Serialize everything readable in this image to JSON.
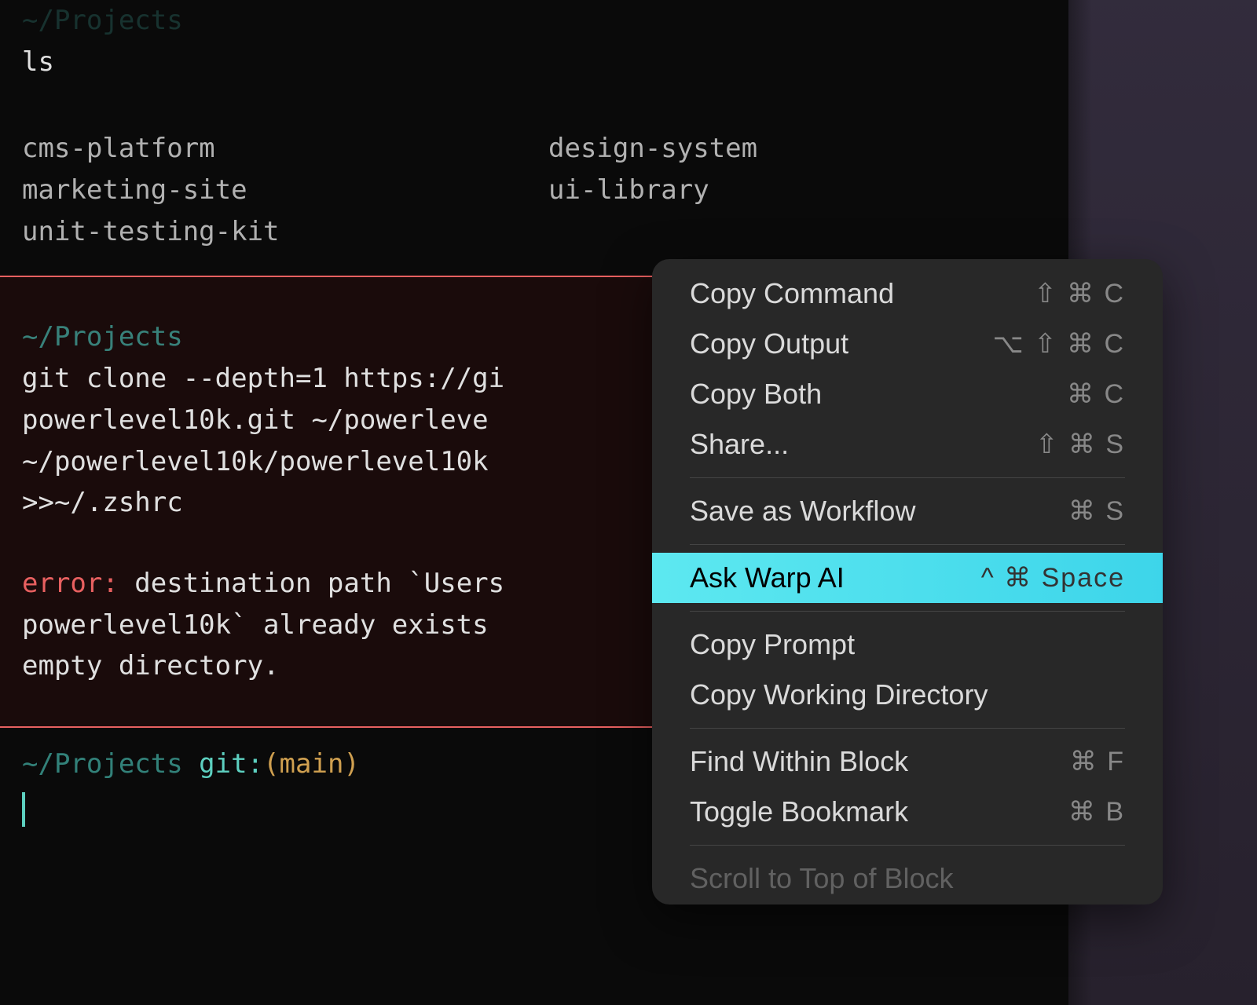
{
  "block1": {
    "prompt_faded": "~/Projects",
    "command": "ls",
    "output": {
      "col1": [
        "cms-platform",
        "marketing-site",
        "unit-testing-kit"
      ],
      "col2": [
        "design-system",
        "ui-library"
      ]
    }
  },
  "block2": {
    "prompt": "~/Projects",
    "command_line1": "git clone --depth=1 https://gi",
    "command_line2": "powerlevel10k.git ~/powerleve",
    "command_line3": "~/powerlevel10k/powerlevel10k",
    "command_line4": ">>~/.zshrc",
    "error_label": "error:",
    "error_text1": " destination path `Users",
    "error_text2": "powerlevel10k` already exists",
    "error_text3": "empty directory."
  },
  "block3": {
    "prompt": "~/Projects",
    "git_label": " git:",
    "git_branch": "(main)"
  },
  "menu": {
    "items": [
      {
        "label": "Copy Command",
        "shortcut": "⇧ ⌘ C"
      },
      {
        "label": "Copy Output",
        "shortcut": "⌥ ⇧ ⌘ C"
      },
      {
        "label": "Copy Both",
        "shortcut": "⌘ C"
      },
      {
        "label": "Share...",
        "shortcut": "⇧ ⌘ S"
      }
    ],
    "workflow": {
      "label": "Save as Workflow",
      "shortcut": "⌘ S"
    },
    "ask_ai": {
      "label": "Ask Warp AI",
      "shortcut": "^ ⌘ Space"
    },
    "copy_prompt": {
      "label": "Copy Prompt"
    },
    "copy_wd": {
      "label": "Copy Working Directory"
    },
    "find": {
      "label": "Find Within Block",
      "shortcut": "⌘ F"
    },
    "bookmark": {
      "label": "Toggle Bookmark",
      "shortcut": "⌘ B"
    },
    "cutoff": "Scroll to Top of Block"
  }
}
